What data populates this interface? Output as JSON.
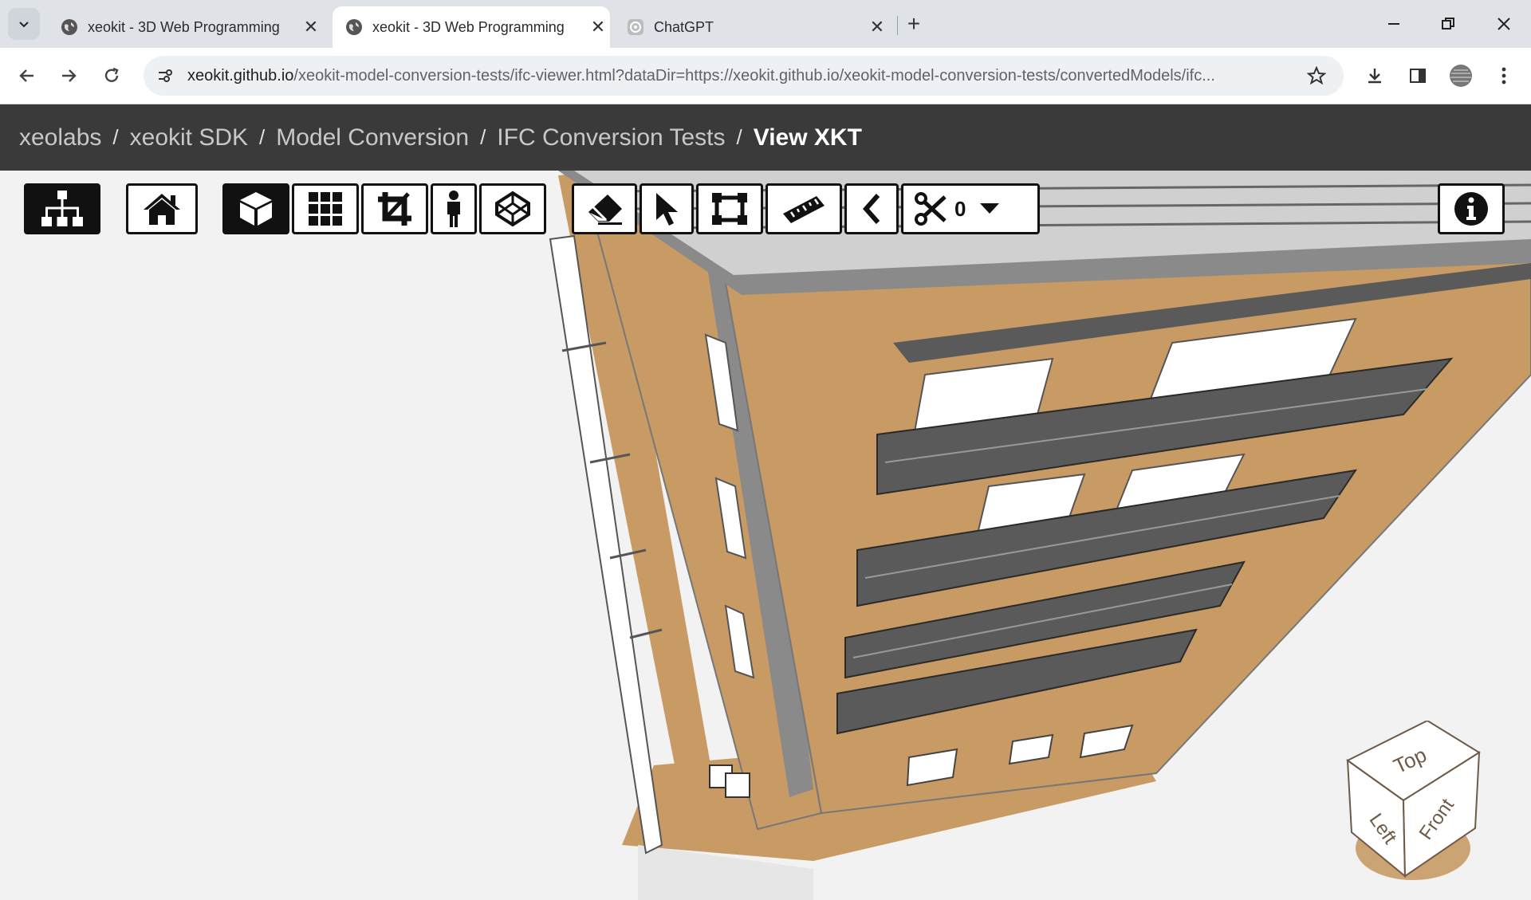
{
  "browser": {
    "tabs": [
      {
        "title": "xeokit - 3D Web Programming",
        "icon": "globe-icon"
      },
      {
        "title": "xeokit - 3D Web Programming",
        "icon": "globe-icon",
        "active": true
      },
      {
        "title": "ChatGPT",
        "icon": "chatgpt-icon"
      }
    ],
    "url_host": "xeokit.github.io",
    "url_rest": "/xeokit-model-conversion-tests/ifc-viewer.html?dataDir=https://xeokit.github.io/xeokit-model-conversion-tests/convertedModels/ifc..."
  },
  "breadcrumb": {
    "items": [
      "xeolabs",
      "xeokit SDK",
      "Model Conversion",
      "IFC Conversion Tests"
    ],
    "current": "View XKT",
    "separator": "/"
  },
  "viewer": {
    "tools": [
      {
        "name": "tree-view-button",
        "icon": "sitemap-icon"
      },
      {
        "name": "home-button",
        "icon": "home-icon"
      },
      {
        "name": "perspective-button",
        "icon": "cube-icon",
        "active": true
      },
      {
        "name": "fit-view-button",
        "icon": "grid-icon"
      },
      {
        "name": "section-crop-button",
        "icon": "crop-icon"
      },
      {
        "name": "first-person-button",
        "icon": "person-icon"
      },
      {
        "name": "xray-button",
        "icon": "codepen-cube-icon"
      },
      {
        "name": "hide-button",
        "icon": "eraser-icon"
      },
      {
        "name": "select-button",
        "icon": "cursor-icon"
      },
      {
        "name": "marquee-button",
        "icon": "marquee-icon"
      },
      {
        "name": "measure-button",
        "icon": "ruler-icon"
      },
      {
        "name": "back-button",
        "icon": "chevron-left-icon"
      },
      {
        "name": "section-planes-button",
        "icon": "scissors-icon"
      },
      {
        "name": "info-button",
        "icon": "info-icon"
      }
    ],
    "section_count": "0",
    "navcube_faces": {
      "top": "Top",
      "left": "Left",
      "front": "Front"
    },
    "colors": {
      "facade": "#c89a64",
      "frame": "#6e6e6e",
      "glass": "#ffffff",
      "background": "#f2f2f2"
    }
  }
}
